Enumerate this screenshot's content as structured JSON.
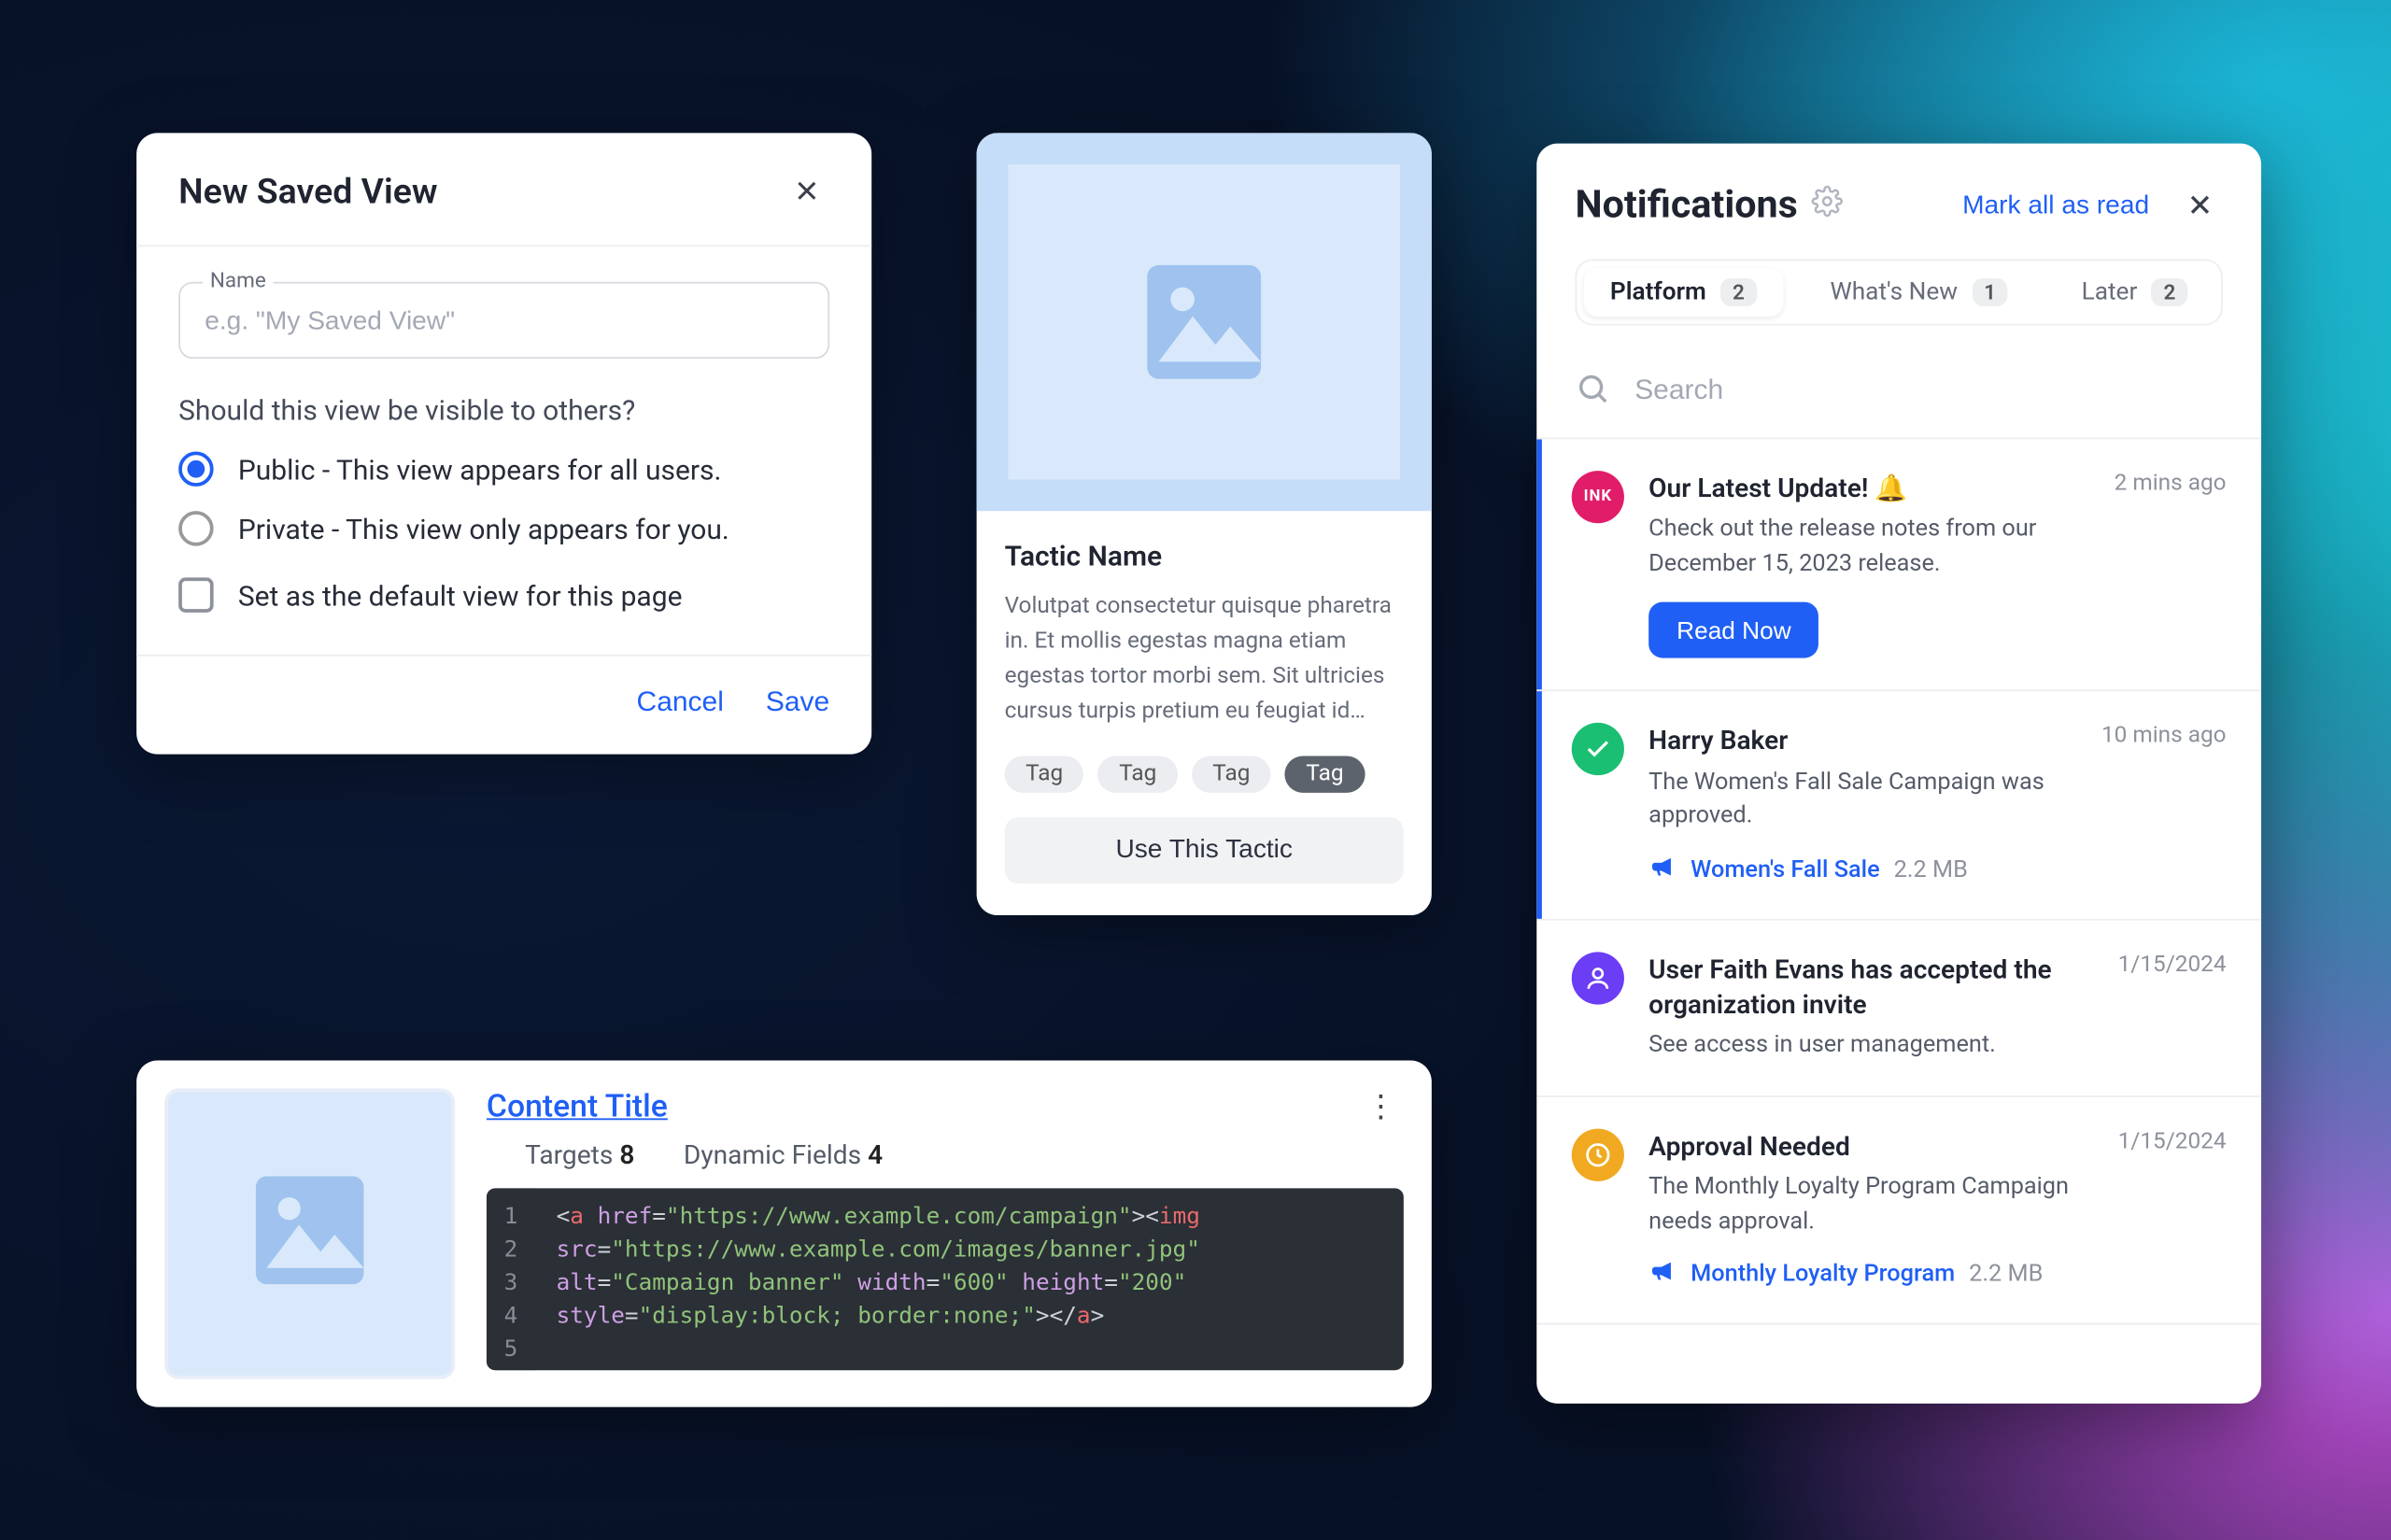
{
  "savedView": {
    "title": "New Saved View",
    "nameLabel": "Name",
    "namePlaceholder": "e.g. \"My Saved View\"",
    "visibilityQuestion": "Should this view be visible to others?",
    "publicLabel": "Public - This view appears for all users.",
    "privateLabel": "Private - This view only appears for you.",
    "defaultLabel": "Set as the default view for this page",
    "cancel": "Cancel",
    "save": "Save"
  },
  "tactic": {
    "name": "Tactic Name",
    "desc": "Volutpat consectetur quisque pharetra in. Et mollis egestas magna etiam egestas tortor morbi sem. Sit ultricies cursus turpis pretium eu feugiat id quis.",
    "tags": [
      "Tag",
      "Tag",
      "Tag",
      "Tag"
    ],
    "cta": "Use This Tactic"
  },
  "notifications": {
    "title": "Notifications",
    "markAll": "Mark all as read",
    "searchPlaceholder": "Search",
    "tabs": [
      {
        "label": "Platform",
        "badge": "2"
      },
      {
        "label": "What's New",
        "badge": "1"
      },
      {
        "label": "Later",
        "badge": "2"
      }
    ],
    "items": [
      {
        "avatarText": "INK",
        "title": "Our Latest Update! 🔔",
        "time": "2 mins ago",
        "message": "Check out the release notes from our December 15, 2023 release.",
        "cta": "Read Now"
      },
      {
        "title": "Harry Baker",
        "time": "10 mins ago",
        "message": "The Women's Fall Sale Campaign was approved.",
        "attachName": "Women's Fall Sale",
        "attachSize": "2.2 MB"
      },
      {
        "title": "User Faith Evans has accepted the organization invite",
        "time": "1/15/2024",
        "message": "See access in user management."
      },
      {
        "title": "Approval Needed",
        "time": "1/15/2024",
        "message": "The Monthly Loyalty Program Campaign needs approval.",
        "attachName": "Monthly Loyalty Program",
        "attachSize": "2.2 MB"
      }
    ]
  },
  "content": {
    "title": "Content Title",
    "targetsLabel": "Targets",
    "targetsValue": "8",
    "dynamicLabel": "Dynamic Fields",
    "dynamicValue": "4",
    "code": {
      "url": "https://www.example.com/campaign",
      "imgSrc": "https://www.example.com/images/banner.jpg",
      "alt": "Campaign banner",
      "width": "600",
      "height": "200",
      "style": "display:block; border:none;"
    }
  }
}
